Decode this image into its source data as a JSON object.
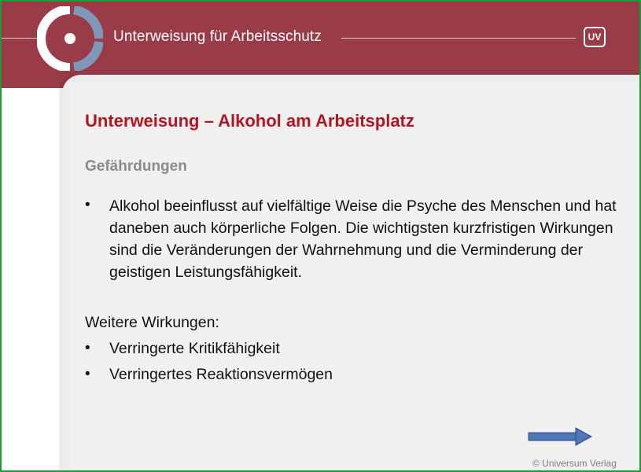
{
  "header": {
    "title": "Unterweisung für Arbeitsschutz",
    "badge": "UV",
    "logo_icon": "uv-circle-logo-icon"
  },
  "slide": {
    "title": "Unterweisung – Alkohol am Arbeitsplatz",
    "section": "Gefährdungen",
    "bullet_symbol": "•",
    "intro_paragraph": "Alkohol beeinflusst auf vielfältige Weise die Psyche des Menschen und hat daneben auch körperliche Folgen. Die wichtigsten kurzfristigen Wirkungen sind die Veränderungen der Wahrnehmung und die Verminderung der geistigen Leistungsfähigkeit.",
    "further_label": "Weitere Wirkungen:",
    "further_items": [
      "Verringerte Kritikfähigkeit",
      "Verringertes Reaktionsvermögen"
    ],
    "next_icon": "right-arrow-icon",
    "copyright": "© Universum Verlag"
  },
  "colors": {
    "banner": "#9a3b48",
    "title_red": "#b01722",
    "frame_green": "#1a9c3a",
    "arrow_blue": "#4f76b6"
  }
}
